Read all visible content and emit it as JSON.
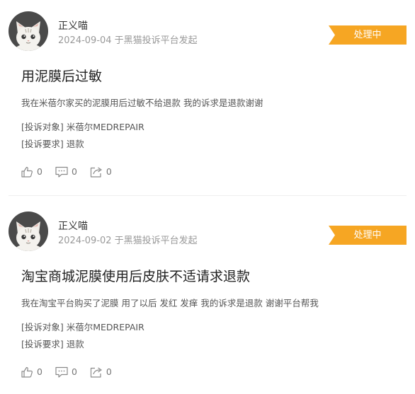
{
  "complaints": [
    {
      "user": "正义喵",
      "meta": "2024-09-04 于黑猫投诉平台发起",
      "status": "处理中",
      "title": "用泥膜后过敏",
      "description": "我在米蓓尔家买的泥膜用后过敏不给退款 我的诉求是退款谢谢",
      "target_label": "[投诉对象]",
      "target_value": "米蓓尔MEDREPAIR",
      "demand_label": "[投诉要求]",
      "demand_value": "退款",
      "likes": "0",
      "comments": "0",
      "shares": "0"
    },
    {
      "user": "正义喵",
      "meta": "2024-09-02 于黑猫投诉平台发起",
      "status": "处理中",
      "title": "淘宝商城泥膜使用后皮肤不适请求退款",
      "description": "我在淘宝平台购买了泥膜 用了以后 发红 发痒 我的诉求是退款 谢谢平台帮我",
      "target_label": "[投诉对象]",
      "target_value": "米蓓尔MEDREPAIR",
      "demand_label": "[投诉要求]",
      "demand_value": "退款",
      "likes": "0",
      "comments": "0",
      "shares": "0"
    }
  ],
  "icons": {
    "like": "thumbs-up-icon",
    "comment": "comment-icon",
    "share": "share-icon"
  },
  "colors": {
    "badge": "#f6a623",
    "avatar_bg": "#4a4a4a"
  }
}
